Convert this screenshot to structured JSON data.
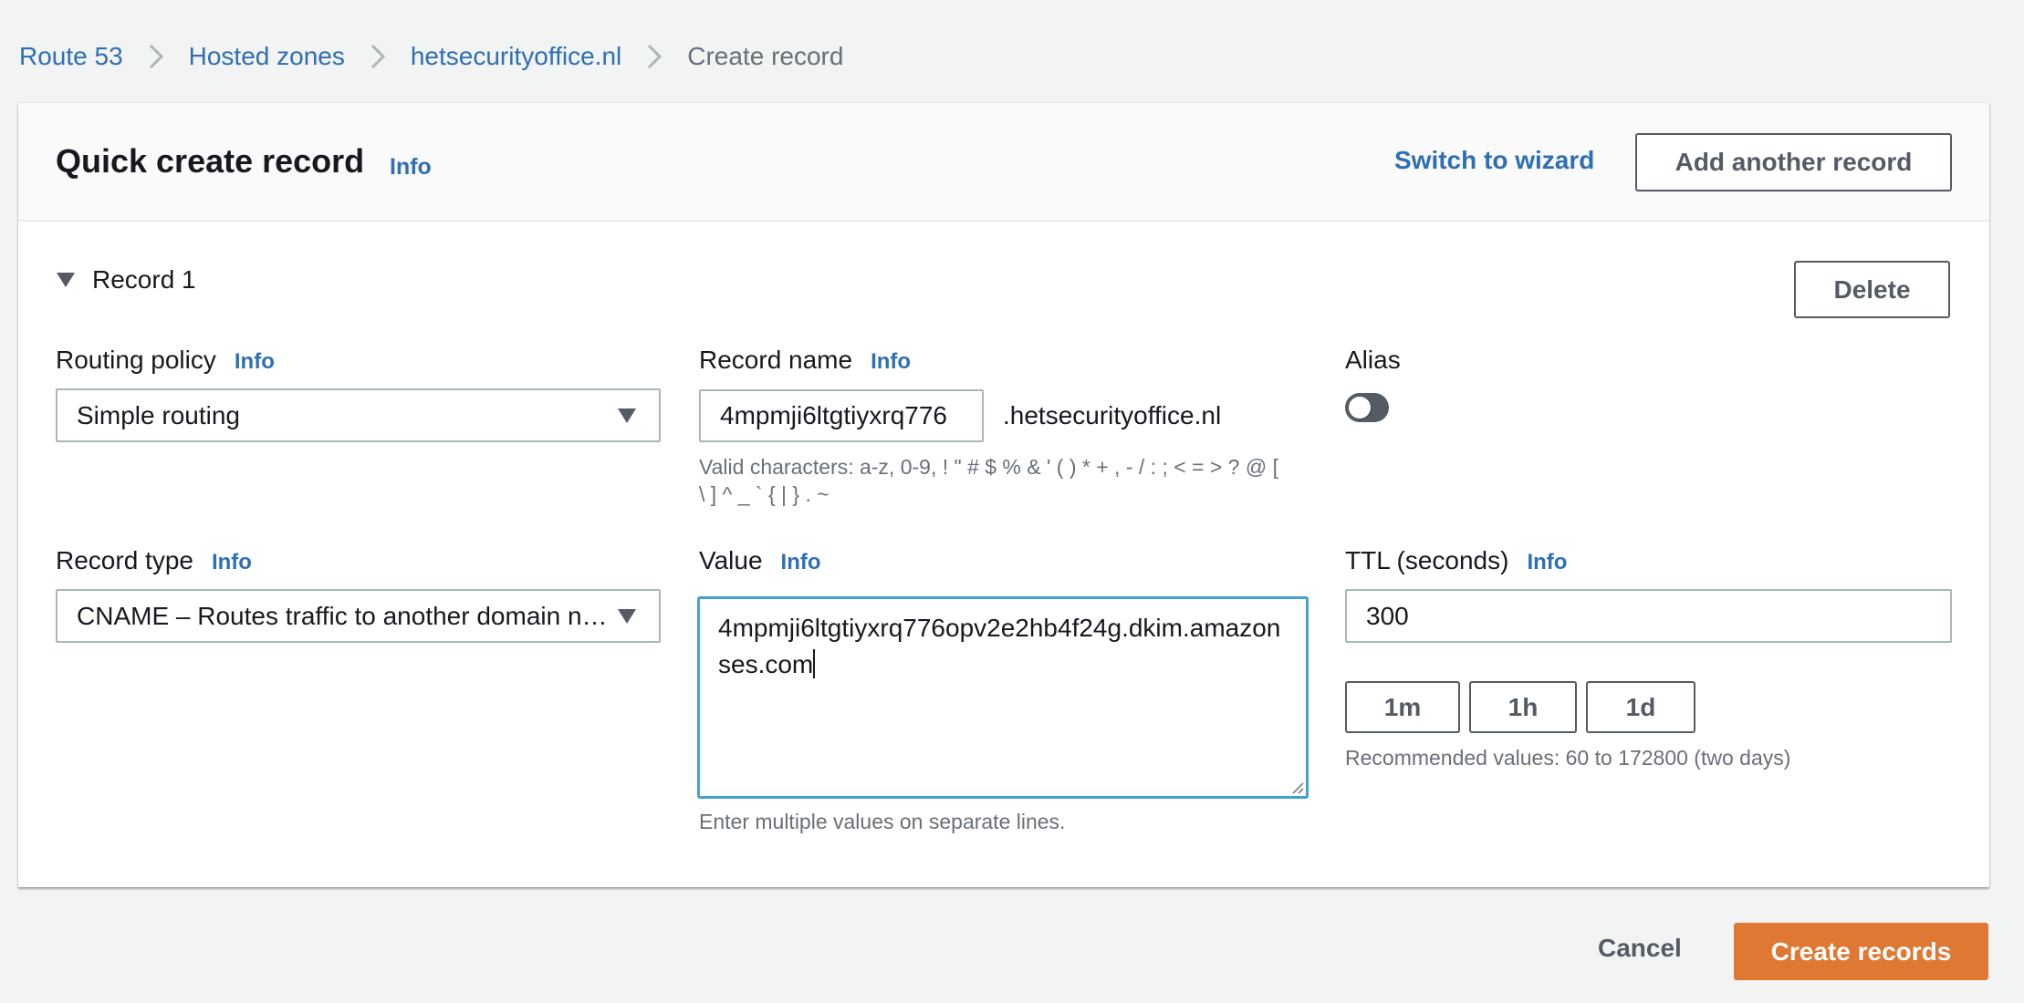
{
  "breadcrumb": {
    "items": [
      {
        "label": "Route 53",
        "link": true
      },
      {
        "label": "Hosted zones",
        "link": true
      },
      {
        "label": "hetsecurityoffice.nl",
        "link": true
      },
      {
        "label": "Create record",
        "link": false
      }
    ]
  },
  "header": {
    "title": "Quick create record",
    "info": "Info",
    "switch_wizard": "Switch to wizard",
    "add_another": "Add another record"
  },
  "record": {
    "title": "Record 1",
    "delete": "Delete",
    "routing_policy": {
      "label": "Routing policy",
      "info": "Info",
      "value": "Simple routing"
    },
    "record_name": {
      "label": "Record name",
      "info": "Info",
      "value": "4mpmji6ltgtiyxrq776",
      "suffix": ".hetsecurityoffice.nl",
      "help_line1": "Valid characters: a-z, 0-9, ! \" # $ % & ' ( ) * + , - / : ; < = > ? @ [",
      "help_line2": "\\ ] ^ _ ` { | } . ~"
    },
    "alias": {
      "label": "Alias",
      "enabled": false
    },
    "record_type": {
      "label": "Record type",
      "info": "Info",
      "value": "CNAME – Routes traffic to another domain name and some AWS resources"
    },
    "value": {
      "label": "Value",
      "info": "Info",
      "text": "4mpmji6ltgtiyxrq776opv2e2hb4f24g.dkim.amazonses.com",
      "help": "Enter multiple values on separate lines."
    },
    "ttl": {
      "label": "TTL (seconds)",
      "info": "Info",
      "value": "300",
      "presets": [
        "1m",
        "1h",
        "1d"
      ],
      "help": "Recommended values: 60 to 172800 (two days)"
    }
  },
  "footer": {
    "cancel": "Cancel",
    "create": "Create records"
  },
  "colors": {
    "link": "#2f6fb3",
    "primary_button": "#df7833",
    "focus_border": "#44a3cc",
    "background": "#f2f3f3"
  }
}
